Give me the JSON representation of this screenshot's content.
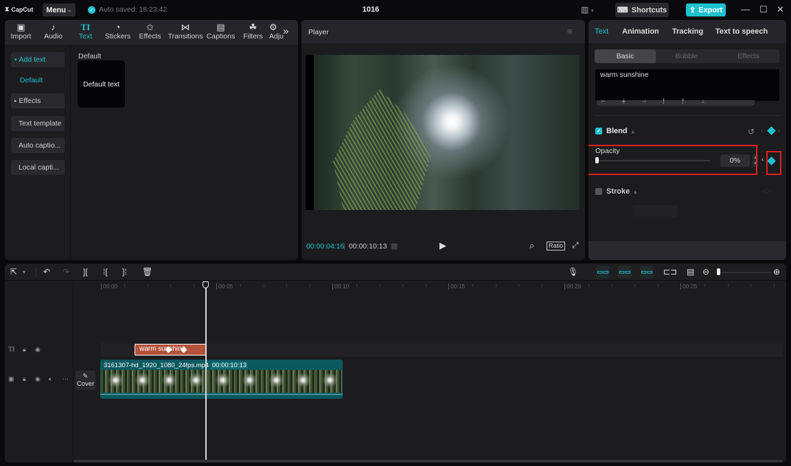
{
  "titlebar": {
    "app_name": "CapCut",
    "menu_label": "Menu",
    "autosave_text": "Auto saved: 18:23:42",
    "project_title": "1016",
    "shortcuts_label": "Shortcuts",
    "export_label": "Export",
    "icons": {
      "layout": "layout-icon",
      "minimize": "minimize-icon",
      "maximize": "maximize-icon",
      "close": "close-icon"
    }
  },
  "media_tabs": [
    {
      "label": "Import",
      "icon": "▣"
    },
    {
      "label": "Audio",
      "icon": "♪"
    },
    {
      "label": "Text",
      "icon": "TI",
      "active": true
    },
    {
      "label": "Stickers",
      "icon": "◔"
    },
    {
      "label": "Effects",
      "icon": "✩"
    },
    {
      "label": "Transitions",
      "icon": "⋈"
    },
    {
      "label": "Captions",
      "icon": "▤"
    },
    {
      "label": "Filters",
      "icon": "☘"
    },
    {
      "label": "Adju",
      "icon": "⚙"
    }
  ],
  "text_subnav": {
    "add_text": "Add text",
    "default": "Default",
    "effects": "Effects",
    "text_template": "Text template",
    "auto_captions": "Auto captio...",
    "local_captions": "Local capti..."
  },
  "text_content": {
    "section_label": "Default",
    "card_label": "Default text"
  },
  "player": {
    "title": "Player",
    "current_time": "00:00:04:16",
    "total_time": "00:00:10:13",
    "ratio_label": "Ratio"
  },
  "inspector": {
    "tabs": [
      "Text",
      "Animation",
      "Tracking",
      "Text to speech"
    ],
    "active_tab": "Text",
    "subtabs": [
      "Basic",
      "Bubble",
      "Effects"
    ],
    "active_subtab": "Basic",
    "text_value": "warm sunshine",
    "blend": {
      "label": "Blend",
      "enabled": true
    },
    "opacity": {
      "label": "Opacity",
      "value_text": "0%",
      "value": 0
    },
    "stroke": {
      "label": "Stroke",
      "enabled": false
    }
  },
  "timeline": {
    "ruler_labels": [
      "00:00",
      "00:05",
      "00:10",
      "00:15",
      "00:20",
      "00:25"
    ],
    "text_clip_label": "warm sunshine",
    "video_clip_name": "3161307-hd_1920_1080_24fps.mp4",
    "video_clip_duration": "00:00:10:13",
    "cover_label": "Cover",
    "text_track_icon": "TI"
  },
  "colors": {
    "accent": "#1fc1cf",
    "text_clip": "#b5523a",
    "video_clip": "#0c5a60",
    "highlight_box": "#e02020"
  }
}
